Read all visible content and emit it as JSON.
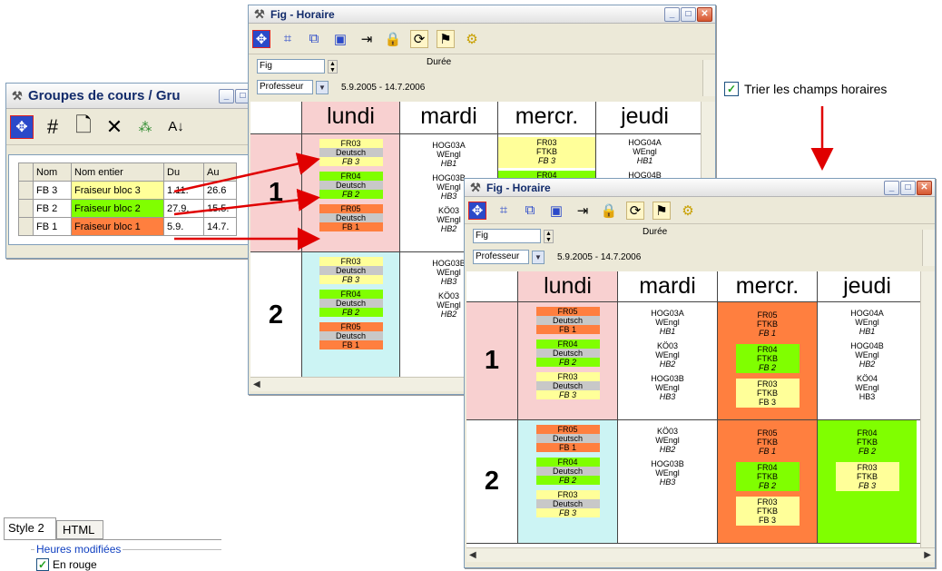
{
  "colors": {
    "yellow": "#ffff99",
    "green": "#80ff00",
    "orange": "#ff7f3f",
    "pink": "#f8d0d0",
    "cyan": "#ccf4f4",
    "grey": "#c8c8c8",
    "arrow": "#e00000"
  },
  "groups_window": {
    "title": "Groupes de cours / Gru",
    "columns": [
      "Nom",
      "Nom entier",
      "Du",
      "Au"
    ],
    "rows": [
      {
        "nom": "FB 3",
        "entier": "Fraiseur bloc 3",
        "du": "1.11.",
        "au": "26.6",
        "color": "#ffff99"
      },
      {
        "nom": "FB 2",
        "entier": "Fraiseur bloc 2",
        "du": "27.9.",
        "au": "15.5.",
        "color": "#80ff00"
      },
      {
        "nom": "FB 1",
        "entier": "Fraiseur bloc 1",
        "du": "5.9.",
        "au": "14.7.",
        "color": "#ff7f3f"
      }
    ]
  },
  "tabs": {
    "style2": "Style 2",
    "html": "HTML"
  },
  "heures": {
    "group_label": "Heures modifiées",
    "option": "En rouge"
  },
  "sort_option": {
    "label": "Trier les champs horaires"
  },
  "back_window": {
    "title": "Fig -  Horaire",
    "field": "Fig",
    "duree": "Durée",
    "role": "Professeur",
    "period": "5.9.2005 - 14.7.2006",
    "days": [
      "lundi",
      "mardi",
      "mercr.",
      "jeudi"
    ],
    "rows": [
      "1",
      "2"
    ],
    "lundi": [
      [
        [
          "FR03",
          "Deutsch",
          "FB 3",
          "yellow"
        ],
        [
          "FR04",
          "Deutsch",
          "FB 2",
          "green"
        ],
        [
          "FR05",
          "Deutsch",
          "FB 1",
          "orange"
        ]
      ],
      [
        [
          "FR03",
          "Deutsch",
          "FB 3",
          "yellow"
        ],
        [
          "FR04",
          "Deutsch",
          "FB 2",
          "green"
        ],
        [
          "FR05",
          "Deutsch",
          "FB 1",
          "orange"
        ]
      ]
    ],
    "mardi": [
      [
        [
          "HOG03A",
          "WEngl",
          "HB1"
        ],
        [
          "HOG03B",
          "WEngl",
          "HB3"
        ],
        [
          "KÖ03",
          "WEngl",
          "HB2"
        ]
      ],
      [
        [
          "HOG03B",
          "WEngl",
          "HB3"
        ],
        [
          "KÖ03",
          "WEngl",
          "HB2"
        ]
      ]
    ],
    "mercr": [
      [
        "FR03",
        "FTKB",
        "FB 3"
      ],
      [
        "FR04",
        ""
      ]
    ],
    "jeudi": [
      [
        "HOG04A",
        "WEngl",
        "HB1"
      ],
      [
        "HOG04B",
        ""
      ]
    ]
  },
  "front_window": {
    "title": "Fig -  Horaire",
    "field": "Fig",
    "duree": "Durée",
    "role": "Professeur",
    "period": "5.9.2005 - 14.7.2006",
    "days": [
      "lundi",
      "mardi",
      "mercr.",
      "jeudi"
    ],
    "rows": [
      "1",
      "2"
    ],
    "lundi": [
      [
        [
          "FR05",
          "Deutsch",
          "FB 1",
          "orange"
        ],
        [
          "FR04",
          "Deutsch",
          "FB 2",
          "green"
        ],
        [
          "FR03",
          "Deutsch",
          "FB 3",
          "yellow"
        ]
      ],
      [
        [
          "FR05",
          "Deutsch",
          "FB 1",
          "orange"
        ],
        [
          "FR04",
          "Deutsch",
          "FB 2",
          "green"
        ],
        [
          "FR03",
          "Deutsch",
          "FB 3",
          "yellow"
        ]
      ]
    ],
    "mardi": [
      [
        [
          "HOG03A",
          "WEngl",
          "HB1"
        ],
        [
          "KÖ03",
          "WEngl",
          "HB2"
        ],
        [
          "HOG03B",
          "WEngl",
          "HB3"
        ]
      ],
      [
        [
          "KÖ03",
          "WEngl",
          "HB2"
        ],
        [
          "HOG03B",
          "WEngl",
          "HB3"
        ]
      ]
    ],
    "mercr": [
      [
        [
          "FR05",
          "FTKB",
          "FB 1",
          "orange"
        ],
        [
          "FR04",
          "FTKB",
          "FB 2",
          "green"
        ],
        [
          "FR03",
          "FTKB",
          "FB 3",
          "yellow"
        ]
      ],
      [
        [
          "FR05",
          "FTKB",
          "FB 1",
          "orange"
        ],
        [
          "FR04",
          "FTKB",
          "FB 2",
          "green"
        ],
        [
          "FR03",
          "FTKB",
          "FB 3",
          "yellow"
        ]
      ]
    ],
    "jeudi": [
      [
        [
          "HOG04A",
          "WEngl",
          "HB1"
        ],
        [
          "HOG04B",
          "WEngl",
          "HB2"
        ],
        [
          "KÖ04",
          "WEngl",
          "HB3"
        ]
      ],
      [
        [
          "FR04",
          "FTKB",
          "FB 2",
          "green"
        ],
        [
          "FR03",
          "FTKB",
          "FB 3",
          "yellow"
        ]
      ]
    ]
  },
  "icons": {
    "tool": "tool-icon",
    "scroll_left": "arrow-left-icon",
    "scroll_right": "arrow-right-icon"
  }
}
